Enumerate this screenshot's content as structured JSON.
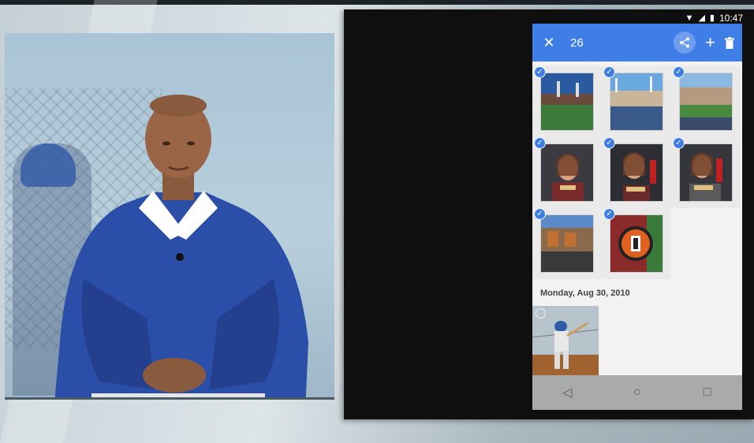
{
  "status_bar": {
    "time": "10:47",
    "icons": [
      "wifi-icon",
      "signal-icon",
      "battery-icon"
    ]
  },
  "app_bar": {
    "close_glyph": "✕",
    "selected_count": "26",
    "actions": [
      "share-icon",
      "add-icon",
      "delete-icon"
    ],
    "plus_glyph": "+",
    "accent": "#3f7ee6"
  },
  "photo_grid": {
    "selected_rows": [
      [
        {
          "subject": "stadium-night",
          "selected": true
        },
        {
          "subject": "stadium-crowd",
          "selected": true
        },
        {
          "subject": "stadium-field",
          "selected": true
        }
      ],
      [
        {
          "subject": "woman-hotdog-1",
          "selected": true
        },
        {
          "subject": "woman-hotdog-2",
          "selected": true
        },
        {
          "subject": "woman-hotdog-3",
          "selected": true
        }
      ],
      [
        {
          "subject": "stadium-stands",
          "selected": true
        },
        {
          "subject": "giants-logo",
          "selected": true
        }
      ]
    ],
    "check_glyph": "✓"
  },
  "date_section": {
    "label": "Monday, Aug 30, 2010",
    "photos": [
      {
        "subject": "baseball-batter",
        "selected": false
      }
    ]
  },
  "nav_bar": {
    "back_glyph": "◁",
    "home_glyph": "○",
    "recents_glyph": "□"
  }
}
